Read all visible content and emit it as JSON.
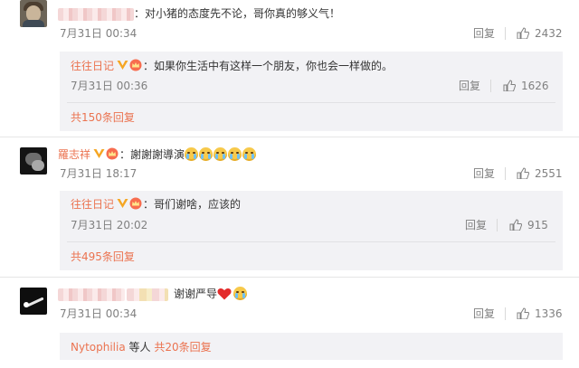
{
  "comments": [
    {
      "text": "：对小猪的态度先不论，哥你真的够义气！",
      "time": "7月31日 00:34",
      "reply_label": "回复",
      "likes": "2432",
      "replies": [
        {
          "username": "往往日记",
          "text": "：如果你生活中有这样一个朋友，你也会一样做的。",
          "time": "7月31日 00:36",
          "reply_label": "回复",
          "likes": "1626"
        }
      ],
      "more_replies": "共150条回复"
    },
    {
      "username": "羅志祥",
      "text": "：謝謝謝導演",
      "time": "7月31日 18:17",
      "reply_label": "回复",
      "likes": "2551",
      "replies": [
        {
          "username": "往往日记",
          "text": "：哥们谢啥，应该的",
          "time": "7月31日 20:02",
          "reply_label": "回复",
          "likes": "915"
        }
      ],
      "more_replies": "共495条回复"
    },
    {
      "text": "谢谢严导",
      "time": "7月31日 00:34",
      "reply_label": "回复",
      "likes": "1336",
      "reply_users": "Nytophilia",
      "reply_users_suffix": "等人",
      "more_replies": "共20条回复"
    }
  ],
  "icons": {
    "verified": "verified-v-icon",
    "vip": "vip-crown-icon",
    "like": "thumbs-up-icon",
    "cry": "crying-face-emoji",
    "heart": "red-heart-emoji"
  },
  "colors": {
    "link": "#eb7350",
    "muted": "#808080",
    "reply_bg": "#f2f2f5",
    "verified_gold": "#f5a623"
  }
}
